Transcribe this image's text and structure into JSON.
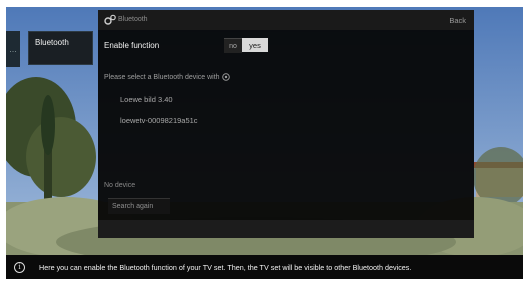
{
  "sidebar": {
    "edge_label": "…",
    "active_item": "Bluetooth"
  },
  "dialog": {
    "title": "Bluetooth",
    "back_label": "Back",
    "enable_label": "Enable function",
    "toggle": {
      "no": "no",
      "yes": "yes",
      "selected": "yes"
    },
    "select_prompt": "Please select a Bluetooth device with",
    "devices": [
      "Loewe bild 3.40",
      "loewetv-00098219a51c"
    ],
    "no_device": "No device",
    "search_again": "Search again"
  },
  "info_bar": {
    "icon": "info-icon",
    "text": "Here you can enable the Bluetooth function of your TV set. Then, the TV set will be visible to other Bluetooth devices."
  },
  "colors": {
    "dialog_bg": "#060606",
    "selected": "#d9d9d9"
  }
}
